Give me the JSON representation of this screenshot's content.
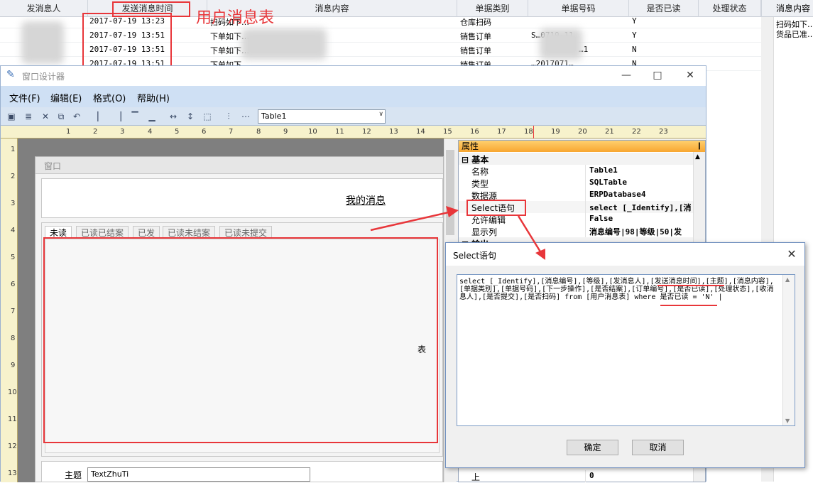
{
  "background_grid": {
    "columns": [
      "发消息人",
      "发送消息时间",
      "消息内容",
      "单据类别",
      "单据号码",
      "是否已读",
      "处理状态"
    ],
    "annotation": "用户消息表",
    "rows": [
      {
        "time": "2017-07-19 13:23",
        "content": "扫码如下…",
        "type": "仓库扫码",
        "read": "Y"
      },
      {
        "time": "2017-07-19 13:51",
        "content": "下单如下…",
        "type": "销售订单",
        "number": "S…0719-11",
        "read": "Y"
      },
      {
        "time": "2017-07-19 13:51",
        "content": "下单如下…",
        "type": "销售订单",
        "number": "…1",
        "read": "N"
      },
      {
        "time": "2017-07-19 13:51",
        "content": "下单如下…",
        "type": "销售订单",
        "number": "…2017071…",
        "read": "N"
      }
    ],
    "side_panel": {
      "header": "消息内容",
      "line1": "扫码如下…",
      "line2": "货品已准…"
    }
  },
  "designer": {
    "title": "窗口设计器",
    "menu": [
      "文件(F)",
      "编辑(E)",
      "格式(O)",
      "帮助(H)"
    ],
    "combo_value": "Table1",
    "ruler_h": [
      "1",
      "2",
      "3",
      "4",
      "5",
      "6",
      "7",
      "8",
      "9",
      "10",
      "11",
      "12",
      "13",
      "14",
      "15",
      "16",
      "17",
      "18",
      "19",
      "20",
      "21",
      "22",
      "23"
    ],
    "ruler_v": [
      "1",
      "2",
      "3",
      "4",
      "5",
      "6",
      "7",
      "8",
      "9",
      "10",
      "11",
      "12",
      "13"
    ],
    "form": {
      "title": "窗口",
      "heading": "我的消息",
      "tabs": [
        "未读",
        "已读已结案",
        "已发",
        "已读未结案",
        "已读未提交"
      ],
      "table_label": "表",
      "bottom_label": "主题",
      "bottom_value": "TextZhuTi"
    },
    "properties": {
      "header": "属性",
      "pin": "❙",
      "group1": "基本",
      "group2": "输出",
      "rows": [
        {
          "k": "名称",
          "v": "Table1"
        },
        {
          "k": "类型",
          "v": "SQLTable"
        },
        {
          "k": "数据源",
          "v": "ERPDatabase4"
        },
        {
          "k": "Select语句",
          "v": "select [_Identify],[消"
        },
        {
          "k": "允许编辑",
          "v": "False"
        },
        {
          "k": "显示列",
          "v": "消息编号|98|等级|50|发"
        }
      ],
      "bottom_row": {
        "k": "上",
        "v": "0"
      }
    }
  },
  "dialog": {
    "title": "Select语句",
    "sql": "select [_Identify],[消息编号],[等级],[发消息人],[发送消息时间],[主题],[消息内容],[单据类别],[单据号码],[下一步操作],[是否结案],[订单编号],[是否已读],[处理状态],[收消息人],[是否提交],[是否扫码] from [用户消息表] where  是否已读 = 'N' |",
    "ok": "确定",
    "cancel": "取消"
  },
  "colors": {
    "annotation_red": "#e8363a",
    "menu_bg": "#cfe0f4",
    "props_header": "#f8a630"
  }
}
